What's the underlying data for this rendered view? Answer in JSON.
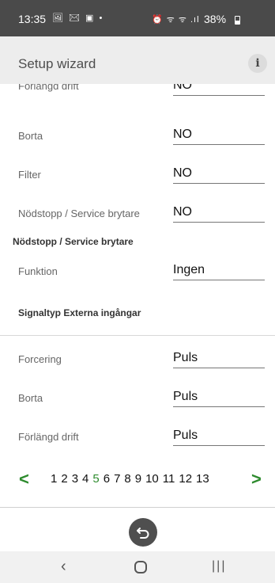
{
  "status_bar": {
    "time": "13:35",
    "left_icons": "🖼 ✉ ▣ •",
    "right_icons": "⏰ ᯤ ᯤ .ıl",
    "battery": "38%"
  },
  "app_bar": {
    "title": "Setup wizard",
    "info_label": "i"
  },
  "fields": [
    {
      "label": "Förlängd drift",
      "value": "NO"
    },
    {
      "label": "Borta",
      "value": "NO"
    },
    {
      "label": "Filter",
      "value": "NO"
    },
    {
      "label": "Nödstopp / Service brytare",
      "value": "NO"
    }
  ],
  "section_nodstopp": {
    "title": "Nödstopp / Service brytare",
    "funktion_label": "Funktion",
    "funktion_value": "Ingen"
  },
  "section_signaltyp": {
    "title": "Signaltyp Externa ingångar",
    "rows": [
      {
        "label": "Forcering",
        "value": "Puls"
      },
      {
        "label": "Borta",
        "value": "Puls"
      },
      {
        "label": "Förlängd drift",
        "value": "Puls"
      }
    ]
  },
  "pager": {
    "prev": "<",
    "next": ">",
    "pages": [
      "1",
      "2",
      "3",
      "4",
      "5",
      "6",
      "7",
      "8",
      "9",
      "10",
      "11",
      "12",
      "13"
    ],
    "current": "5"
  },
  "colors": {
    "accent_green": "#2e8b2e",
    "status_bar": "#4a4a4a",
    "app_bar": "#ededed"
  },
  "icons": {
    "info": "info-icon",
    "undo": "undo-icon",
    "nav_back": "nav-back-icon",
    "nav_home": "nav-home-icon",
    "nav_recent": "nav-recent-icon"
  }
}
